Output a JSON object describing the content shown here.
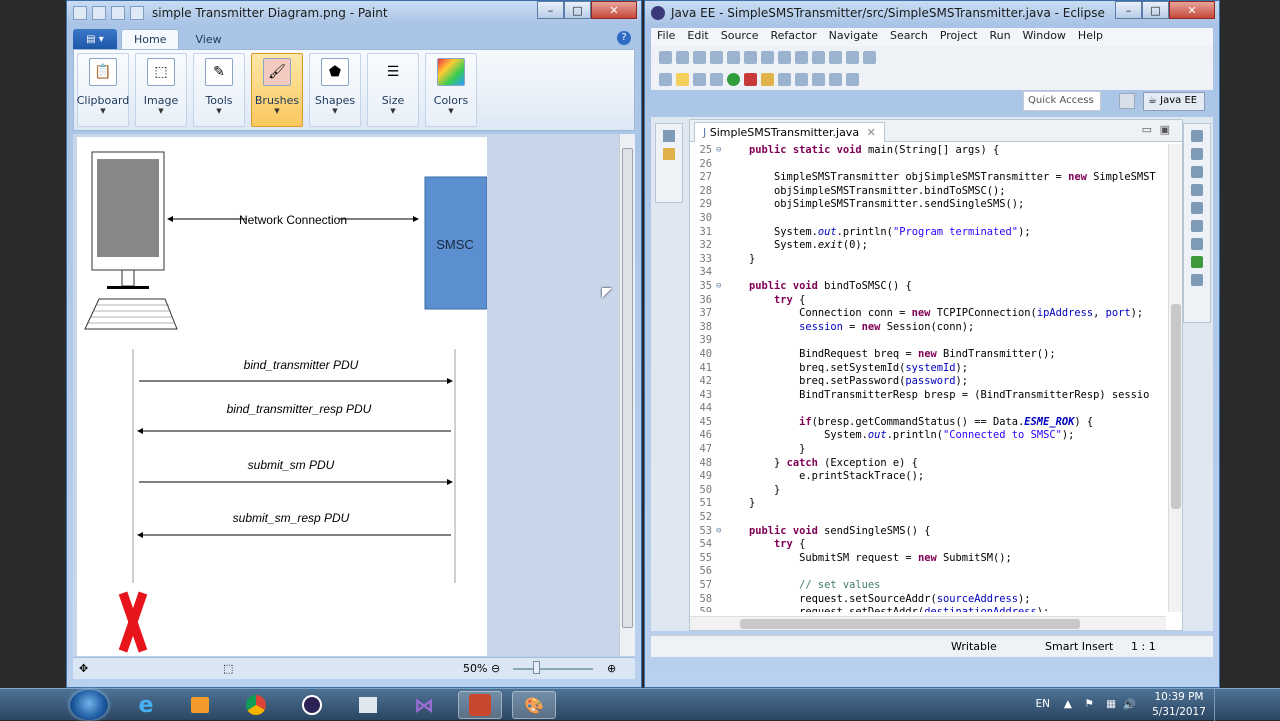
{
  "paint": {
    "title": "simple Transmitter Diagram.png - Paint",
    "tabs": [
      "Home",
      "View"
    ],
    "ribbon_groups": [
      "Clipboard",
      "Image",
      "Tools",
      "Brushes",
      "Shapes",
      "Size",
      "Colors"
    ],
    "zoom": "50%",
    "diagram": {
      "network_connection": "Network Connection",
      "smsc": "SMSC",
      "pdus": [
        "bind_transmitter PDU",
        "bind_transmitter_resp PDU",
        "submit_sm PDU",
        "submit_sm_resp PDU"
      ]
    }
  },
  "eclipse": {
    "title": "Java EE - SimpleSMSTransmitter/src/SimpleSMSTransmitter.java - Eclipse",
    "menu": [
      "File",
      "Edit",
      "Source",
      "Refactor",
      "Navigate",
      "Search",
      "Project",
      "Run",
      "Window",
      "Help"
    ],
    "quick_access": "Quick Access",
    "perspective": "Java EE",
    "editor_tab": "SimpleSMSTransmitter.java",
    "status": {
      "writable": "Writable",
      "insert": "Smart Insert",
      "position": "1 : 1"
    },
    "code_lines": [
      {
        "n": "25",
        "t": "    public static void main(String[] args) {"
      },
      {
        "n": "26",
        "t": ""
      },
      {
        "n": "27",
        "t": "        SimpleSMSTransmitter objSimpleSMSTransmitter = new SimpleSMST"
      },
      {
        "n": "28",
        "t": "        objSimpleSMSTransmitter.bindToSMSC();"
      },
      {
        "n": "29",
        "t": "        objSimpleSMSTransmitter.sendSingleSMS();"
      },
      {
        "n": "30",
        "t": ""
      },
      {
        "n": "31",
        "t": "        System.out.println(\"Program terminated\");"
      },
      {
        "n": "32",
        "t": "        System.exit(0);"
      },
      {
        "n": "33",
        "t": "    }"
      },
      {
        "n": "34",
        "t": ""
      },
      {
        "n": "35",
        "t": "    public void bindToSMSC() {"
      },
      {
        "n": "36",
        "t": "        try {"
      },
      {
        "n": "37",
        "t": "            Connection conn = new TCPIPConnection(ipAddress, port);"
      },
      {
        "n": "38",
        "t": "            session = new Session(conn);"
      },
      {
        "n": "39",
        "t": ""
      },
      {
        "n": "40",
        "t": "            BindRequest breq = new BindTransmitter();"
      },
      {
        "n": "41",
        "t": "            breq.setSystemId(systemId);"
      },
      {
        "n": "42",
        "t": "            breq.setPassword(password);"
      },
      {
        "n": "43",
        "t": "            BindTransmitterResp bresp = (BindTransmitterResp) sessio"
      },
      {
        "n": "44",
        "t": ""
      },
      {
        "n": "45",
        "t": "            if(bresp.getCommandStatus() == Data.ESME_ROK) {"
      },
      {
        "n": "46",
        "t": "                System.out.println(\"Connected to SMSC\");"
      },
      {
        "n": "47",
        "t": "            }"
      },
      {
        "n": "48",
        "t": "        } catch (Exception e) {"
      },
      {
        "n": "49",
        "t": "            e.printStackTrace();"
      },
      {
        "n": "50",
        "t": "        }"
      },
      {
        "n": "51",
        "t": "    }"
      },
      {
        "n": "52",
        "t": ""
      },
      {
        "n": "53",
        "t": "    public void sendSingleSMS() {"
      },
      {
        "n": "54",
        "t": "        try {"
      },
      {
        "n": "55",
        "t": "            SubmitSM request = new SubmitSM();"
      },
      {
        "n": "56",
        "t": ""
      },
      {
        "n": "57",
        "t": "            // set values"
      },
      {
        "n": "58",
        "t": "            request.setSourceAddr(sourceAddress);"
      },
      {
        "n": "59",
        "t": "            request.setDestAddr(destinationAddress);"
      }
    ]
  },
  "taskbar": {
    "language": "EN",
    "time": "10:39 PM",
    "date": "5/31/2017"
  }
}
